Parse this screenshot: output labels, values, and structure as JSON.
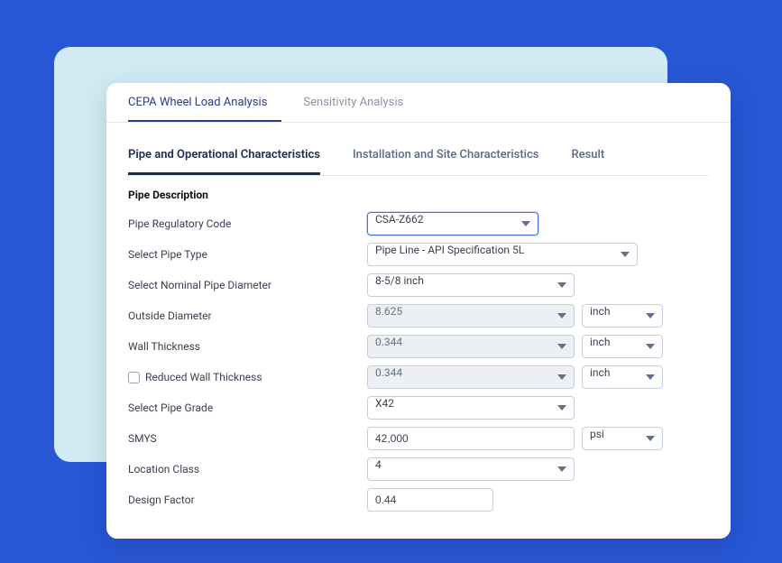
{
  "topTabs": {
    "active": "CEPA Wheel Load Analysis",
    "inactive": "Sensitivity Analysis"
  },
  "subTabs": {
    "t1": "Pipe and Operational Characteristics",
    "t2": "Installation and Site Characteristics",
    "t3": "Result"
  },
  "sectionHeading": "Pipe Description",
  "fields": {
    "regulatoryCode": {
      "label": "Pipe Regulatory Code",
      "value": "CSA-Z662"
    },
    "pipeType": {
      "label": "Select Pipe Type",
      "value": "Pipe Line - API Specification 5L"
    },
    "nominalDiameter": {
      "label": "Select Nominal Pipe Diameter",
      "value": "8-5/8 inch"
    },
    "outsideDiameter": {
      "label": "Outside Diameter",
      "value": "8.625",
      "unit": "inch"
    },
    "wallThickness": {
      "label": "Wall Thickness",
      "value": "0.344",
      "unit": "inch"
    },
    "reducedWall": {
      "label": "Reduced Wall Thickness",
      "value": "0.344",
      "unit": "inch"
    },
    "pipeGrade": {
      "label": "Select Pipe Grade",
      "value": "X42"
    },
    "smys": {
      "label": "SMYS",
      "value": "42,000",
      "unit": "psi"
    },
    "locationClass": {
      "label": "Location Class",
      "value": "4"
    },
    "designFactor": {
      "label": "Design Factor",
      "value": "0.44"
    }
  }
}
